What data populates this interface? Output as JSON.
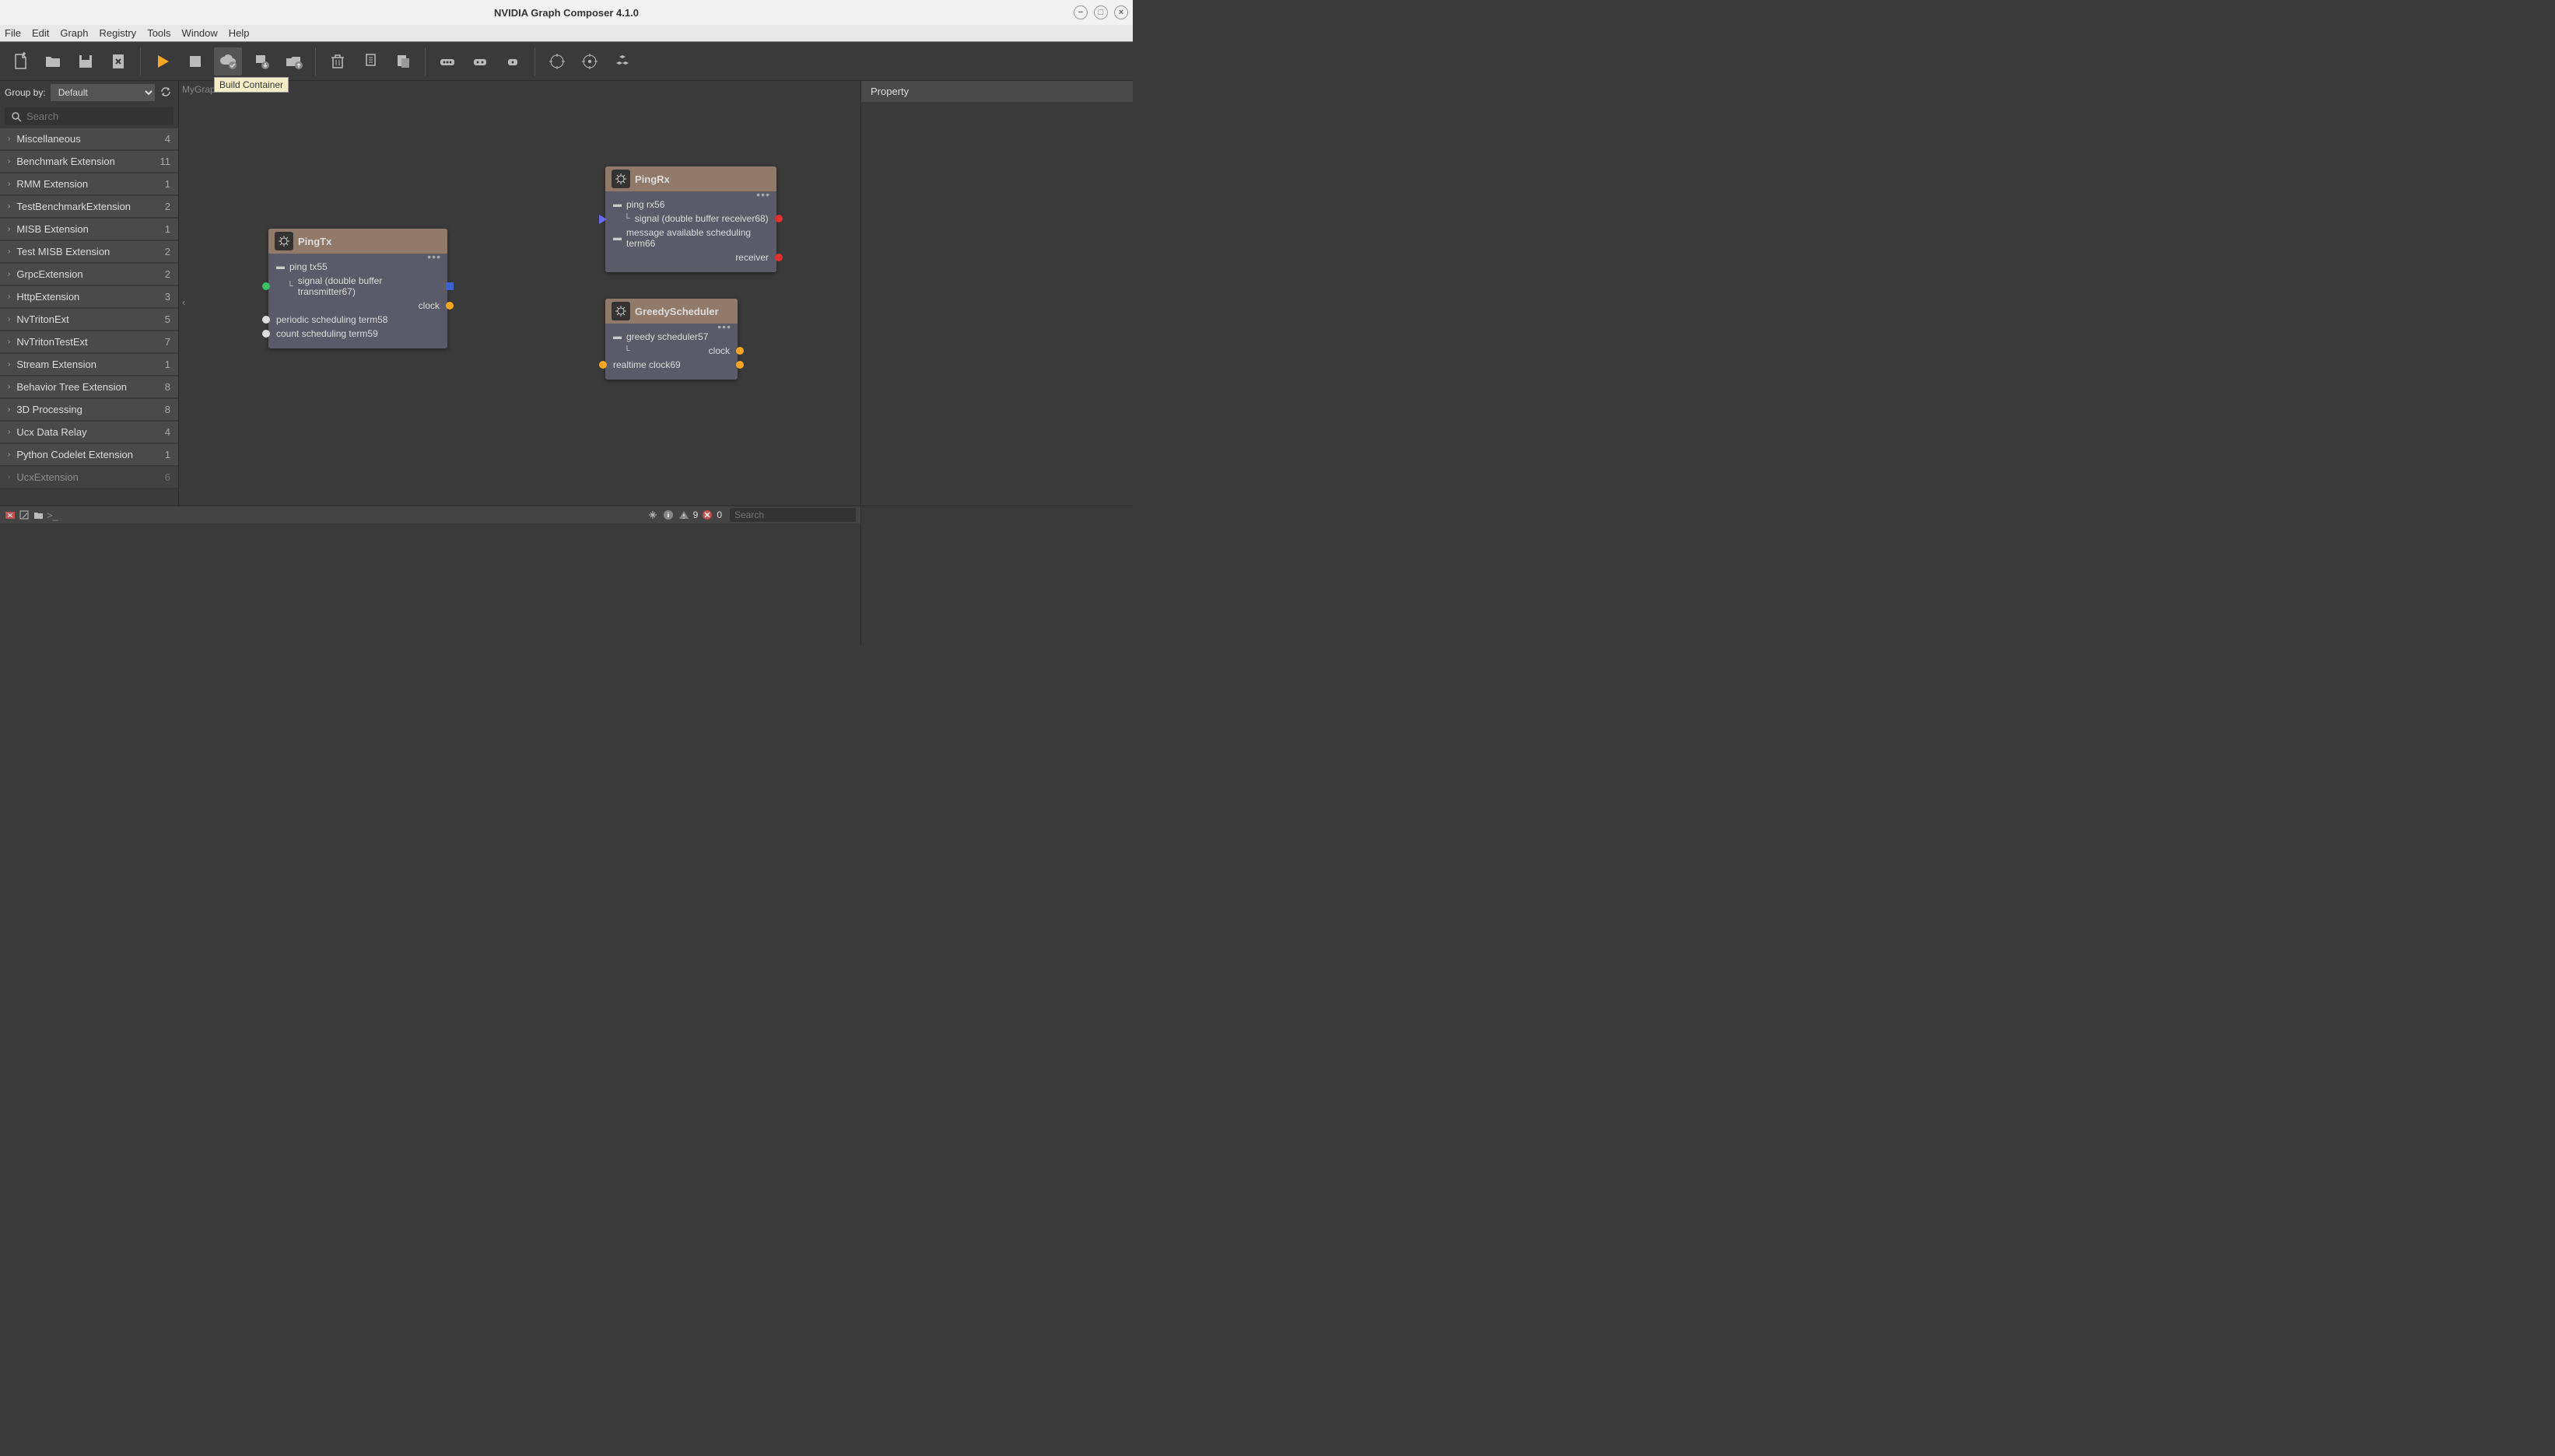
{
  "window": {
    "title": "NVIDIA Graph Composer 4.1.0"
  },
  "menubar": [
    "File",
    "Edit",
    "Graph",
    "Registry",
    "Tools",
    "Window",
    "Help"
  ],
  "toolbar": {
    "tooltip_build_container": "Build Container"
  },
  "sidebar": {
    "groupby_label": "Group by:",
    "groupby_value": "Default",
    "search_placeholder": "Search",
    "items": [
      {
        "name": "Miscellaneous",
        "count": "4"
      },
      {
        "name": "Benchmark Extension",
        "count": "11"
      },
      {
        "name": "RMM Extension",
        "count": "1"
      },
      {
        "name": "TestBenchmarkExtension",
        "count": "2"
      },
      {
        "name": "MISB Extension",
        "count": "1"
      },
      {
        "name": "Test MISB Extension",
        "count": "2"
      },
      {
        "name": "GrpcExtension",
        "count": "2"
      },
      {
        "name": "HttpExtension",
        "count": "3"
      },
      {
        "name": "NvTritonExt",
        "count": "5"
      },
      {
        "name": "NvTritonTestExt",
        "count": "7"
      },
      {
        "name": "Stream Extension",
        "count": "1"
      },
      {
        "name": "Behavior Tree Extension",
        "count": "8"
      },
      {
        "name": "3D Processing",
        "count": "8"
      },
      {
        "name": "Ucx Data Relay",
        "count": "4"
      },
      {
        "name": "Python Codelet Extension",
        "count": "1"
      },
      {
        "name": "UcxExtension",
        "count": "6"
      }
    ]
  },
  "canvas": {
    "tab": "MyGraph",
    "nodes": {
      "pingtx": {
        "title": "PingTx",
        "rows": {
          "r0": "ping tx55",
          "r1": "signal (double buffer transmitter67)",
          "r2": "clock",
          "r3": "periodic scheduling term58",
          "r4": "count scheduling term59"
        }
      },
      "pingrx": {
        "title": "PingRx",
        "rows": {
          "r0": "ping rx56",
          "r1": "signal (double buffer receiver68)",
          "r2": "message available scheduling term66",
          "r3": "receiver"
        }
      },
      "greedy": {
        "title": "GreedyScheduler",
        "rows": {
          "r0": "greedy scheduler57",
          "r1": "clock",
          "r2": "realtime clock69"
        }
      }
    }
  },
  "right_panel": {
    "header": "Property"
  },
  "console": {
    "search_placeholder": "Search",
    "warn_count": "9",
    "err_count": "0"
  }
}
